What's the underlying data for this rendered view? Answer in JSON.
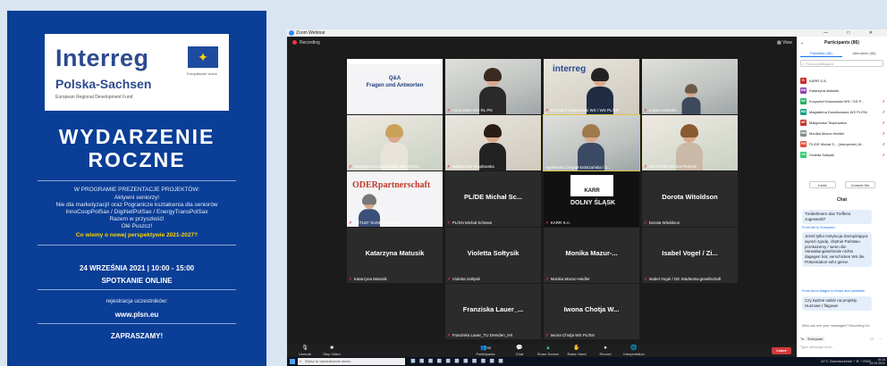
{
  "poster": {
    "logo_main": "Interreg",
    "logo_region": "Polska-Sachsen",
    "logo_sub": "European Regional Development Fund",
    "eu_caption": "Europäische Union",
    "title_line1": "WYDARZENIE",
    "title_line2": "ROCZNE",
    "program_lines": [
      "W PROGRAMIE PREZENTACJE PROJEKTÓW:",
      "Aktywni seniorzy!",
      "Nie dla marketyzacji! oraz Pogranicze kształcenia dla seniorów",
      "InnoCoopPolSax / DigiNetPolSax / EnergyTransPolSax",
      "Razem w przyszłość!",
      "Olé Puszcz!",
      "Co wiemy o nowej perspektywie 2021-2027?"
    ],
    "date": "24 WRZEŚNIA 2021  |  10:00 - 15:00",
    "online": "SPOTKANIE ONLINE",
    "registration": "rejestracja uczestników:",
    "website": "www.plsn.eu",
    "invite": "ZAPRASZAMY!"
  },
  "zoom": {
    "window_title": "Zoom Webinar",
    "window_controls": "— □ ✕",
    "recording": "Recording",
    "view": "View",
    "slide_title": "Q&A",
    "slide_subtitle": "Fragen und Antworten",
    "tiles": [
      {
        "name": "",
        "big": ""
      },
      {
        "name": "Anna Stein WS RL PN",
        "big": ""
      },
      {
        "name": "Krzysztof Kolanowski WS / WS PL/SN",
        "big": ""
      },
      {
        "name": "Lukas Kotzerke ...",
        "big": ""
      },
      {
        "name": "Magdalena Dudzikowska WS PL/SN",
        "big": ""
      },
      {
        "name": "Małgorzata Teoplowska",
        "big": ""
      },
      {
        "name": "Agnieszka Cierpiał-Dobrzańska / Z...",
        "big": ""
      },
      {
        "name": "WS PL/SN Dorota Pietrzyk",
        "big": ""
      },
      {
        "name": "DETLEF SUNDERMANN",
        "big": ""
      },
      {
        "name": "PL/SN Michał Schewe",
        "big": "PL/DE Michał Sc..."
      },
      {
        "name": "KARR S.A.",
        "big": ""
      },
      {
        "name": "Dorota Witoldson",
        "big": "Dorota Witoldson"
      },
      {
        "name": "Katarzyna Matusik",
        "big": "Katarzyna Matusik"
      },
      {
        "name": "Violetta Sołtysik",
        "big": "Violetta Sołtysik"
      },
      {
        "name": "Monika Mazur-Heidler",
        "big": "Monika Mazur-..."
      },
      {
        "name": "Isabel Vogel / DE Stadtentw.gesellschaft",
        "big": "Isabel Vogel / Zi..."
      },
      {
        "name": "Franziska Lauer_TU Dresden_IHI",
        "big": "Franziska Lauer_..."
      },
      {
        "name": "Iwona Chotja WS PL/SN",
        "big": "Iwona Chotja W..."
      }
    ],
    "karr_label": "KARR",
    "dolny_label": "DOLNY ŚLĄSK",
    "oder_label": "ODERpartnerschaft",
    "toolbar": {
      "unmute": "Unmute",
      "stop_video": "Stop Video",
      "participants": "Participants",
      "participants_count": "86",
      "chat": "Chat",
      "share_screen": "Share Screen",
      "raise_hand": "Raise Hand",
      "record": "Record",
      "interpretation": "Interpretation",
      "leave": "Leave"
    }
  },
  "taskbar": {
    "search_placeholder": "Wpisz tu wyszukiwane słowo",
    "tray": "24°C Zachmurzenie  ^  ⊕ ◔ ENG",
    "time": "10:14",
    "date": "24.09.2021"
  },
  "participants_panel": {
    "title": "Participants (86)",
    "tab_panelists": "Panelists (18)",
    "tab_attendees": "Attendees (68)",
    "find_placeholder": "Find a participant",
    "list": [
      {
        "initials": "K",
        "name": "KARR S.A.",
        "color": "#c9302c"
      },
      {
        "initials": "KM",
        "name": "Katarzyna Matusik",
        "color": "#8e44ad"
      },
      {
        "initials": "KK",
        "name": "Krzysztof Kolanowski WS / GS P...",
        "color": "#27ae60"
      },
      {
        "initials": "MD",
        "name": "Magdalena Dudzikowska WS PL/SN",
        "color": "#16a085"
      },
      {
        "initials": "MT",
        "name": "Małgorzata Teoplowska",
        "color": "#c0392b"
      },
      {
        "initials": "MM",
        "name": "Monika Mazur-Heidler",
        "color": "#7f8c8d"
      },
      {
        "initials": "PM",
        "name": "PL/DE Michał S... (Interpreter) W...",
        "color": "#e74c3c"
      },
      {
        "initials": "VS",
        "name": "Violetta Sołtysik",
        "color": "#2ecc71"
      }
    ],
    "invite_btn": "Invite",
    "unmute_btn": "Unmute Me"
  },
  "chat": {
    "title": "Chat",
    "msg1": "Treibehmern das Treffens zugesandt?",
    "meta1": "From Me to Everyone:",
    "msg2": "Jeżeli tylko Instytucja Zarządzająca wyrazi zgodę, chętnie Państwu przekażemy / wenn die Verwaltungsbehörde nichts dagegen hat, verschicken Wir die Präsentation sehr gerne.",
    "meta2": "From Anna Magoń to Hosts and panelists:",
    "msg3": "Czy będzie nabór na projekty Hurzowe / flagowe",
    "who_can_see": "Who can see your messages? Recording On",
    "to_label": "To:",
    "to_value": "Everyone",
    "type_placeholder": "Type message here..."
  }
}
